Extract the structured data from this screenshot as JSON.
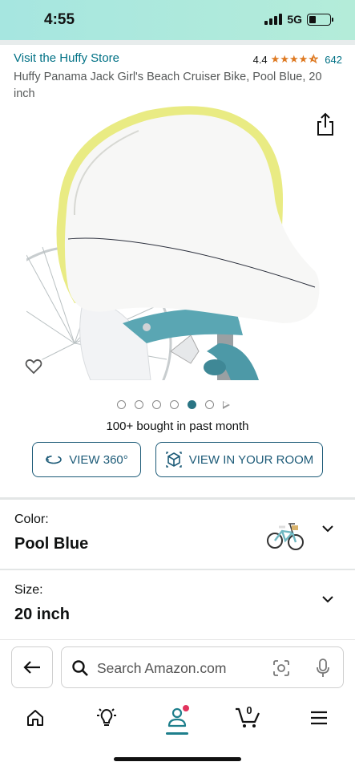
{
  "status": {
    "time": "4:55",
    "network": "5G",
    "battery_level": 0.3
  },
  "header": {
    "store_link": "Visit the Huffy Store",
    "rating_value": "4.4",
    "rating_stars": 4.5,
    "rating_count": "642",
    "title": "Huffy Panama Jack Girl's Beach Cruiser Bike, Pool Blue, 20 inch"
  },
  "gallery": {
    "image_count": 6,
    "active_index": 4,
    "has_video": true,
    "image_icon": "bike-seat-photo"
  },
  "social_proof": "100+ bought in past month",
  "actions": {
    "view_360": "VIEW 360°",
    "view_in_room": "VIEW IN YOUR ROOM"
  },
  "color_option": {
    "label": "Color:",
    "value": "Pool Blue",
    "thumbnail_icon": "bike-thumbnail"
  },
  "size_option": {
    "label": "Size:",
    "value": "20 inch"
  },
  "search": {
    "placeholder": "Search Amazon.com"
  },
  "tabs": [
    {
      "name": "home",
      "icon": "home-icon"
    },
    {
      "name": "inspire",
      "icon": "lightbulb-icon"
    },
    {
      "name": "account",
      "icon": "person-icon",
      "active": true
    },
    {
      "name": "cart",
      "icon": "cart-icon",
      "count": "0"
    },
    {
      "name": "menu",
      "icon": "menu-icon"
    }
  ],
  "colors": {
    "link": "#007185",
    "star": "#de7921",
    "accent": "#1d5b78",
    "active_tab": "#1e7f8c",
    "status_bar": "#a6e6e0"
  }
}
